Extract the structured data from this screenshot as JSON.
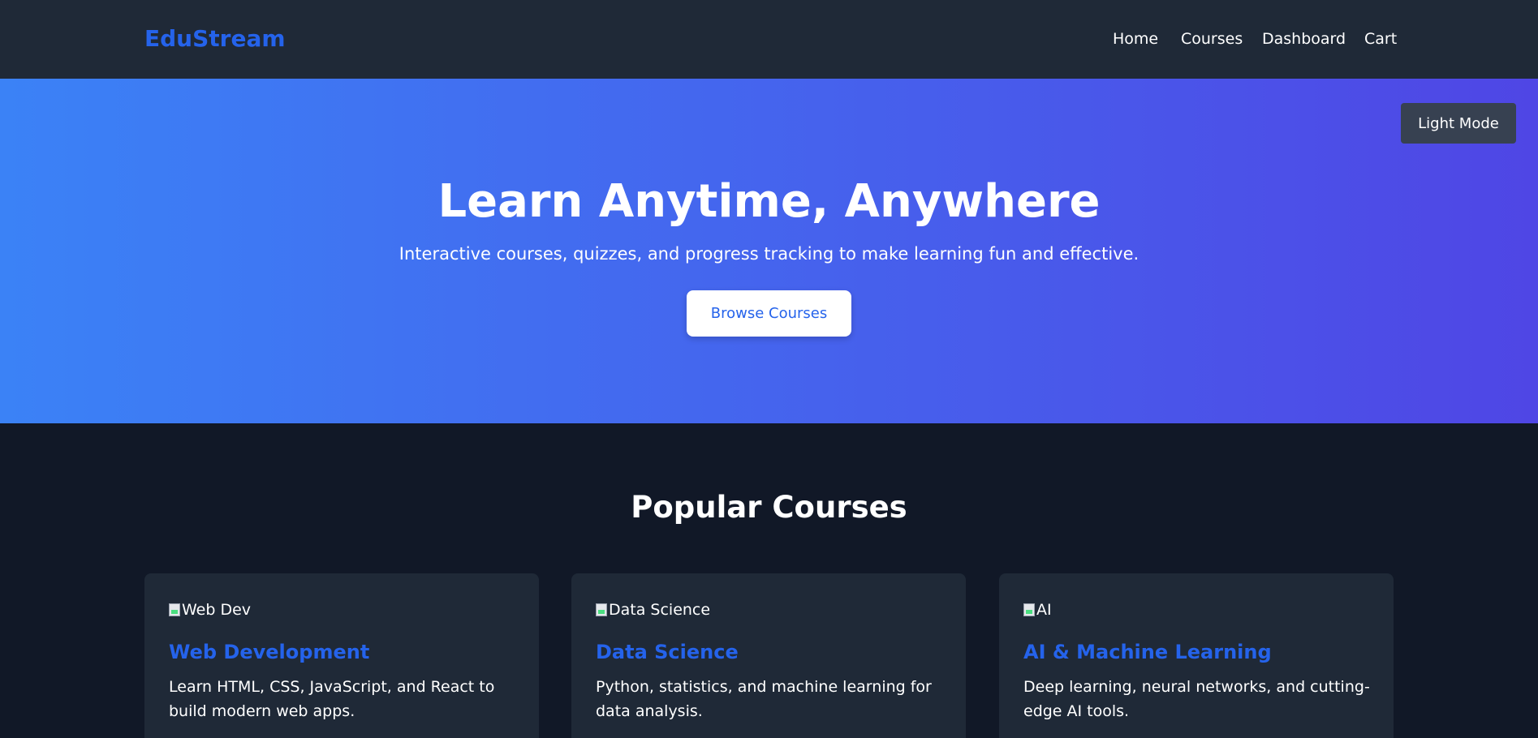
{
  "navbar": {
    "brand": "EduStream",
    "links": [
      "Home",
      "Courses",
      "Dashboard",
      "Cart"
    ]
  },
  "hero": {
    "theme_toggle": "Light Mode",
    "title": "Learn Anytime, Anywhere",
    "subtitle": "Interactive courses, quizzes, and progress tracking to make learning fun and effective.",
    "cta": "Browse Courses"
  },
  "courses": {
    "title": "Popular Courses",
    "items": [
      {
        "image_alt": "Web Dev",
        "title": "Web Development",
        "description": "Learn HTML, CSS, JavaScript, and React to build modern web apps."
      },
      {
        "image_alt": "Data Science",
        "title": "Data Science",
        "description": "Python, statistics, and machine learning for data analysis."
      },
      {
        "image_alt": "AI",
        "title": "AI & Machine Learning",
        "description": "Deep learning, neural networks, and cutting-edge AI tools."
      }
    ]
  },
  "colors": {
    "navbar_bg": "#1f2937",
    "brand": "#2563eb",
    "hero_gradient_start": "#3b82f6",
    "hero_gradient_end": "#4f46e5",
    "page_bg": "#111827",
    "card_bg": "#1f2937",
    "card_title": "#2563eb",
    "toggle_bg": "#374151"
  },
  "icons": {
    "broken_image": "broken-image-icon"
  }
}
